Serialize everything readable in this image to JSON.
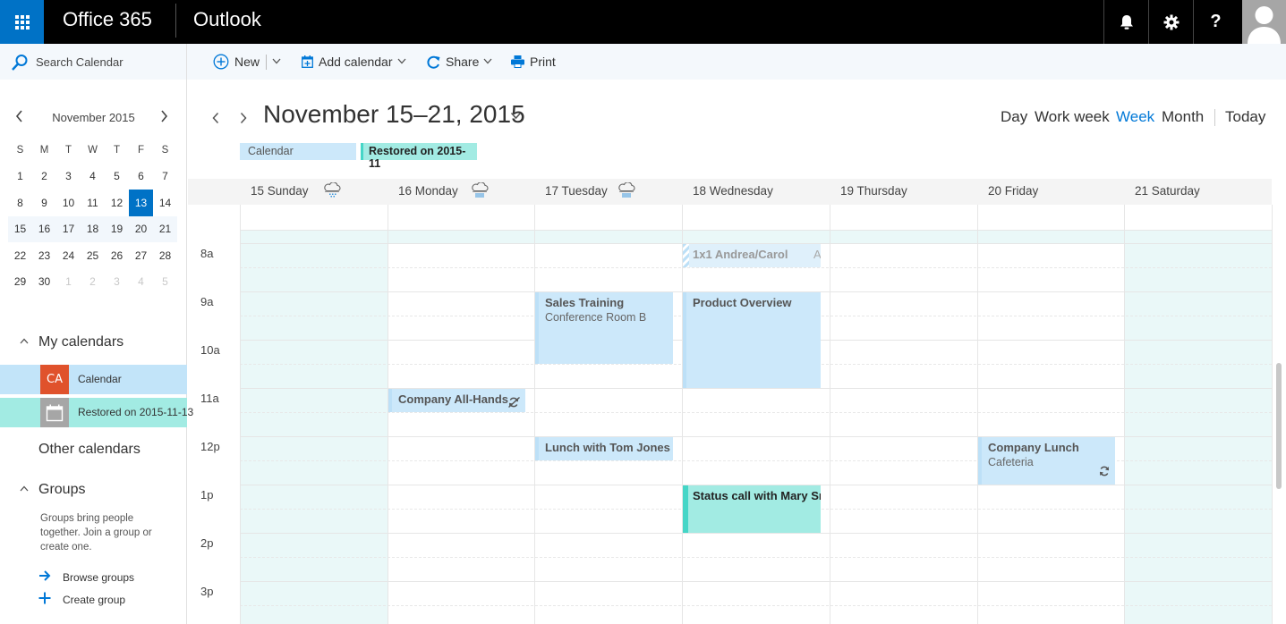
{
  "topbar": {
    "brand": "Office 365",
    "app": "Outlook",
    "icons": [
      "app-launcher-icon",
      "bell-icon",
      "gear-icon",
      "help-icon",
      "avatar-icon"
    ],
    "help_label": "?"
  },
  "commandbar": {
    "search_placeholder": "Search Calendar",
    "new_label": "New",
    "add_calendar_label": "Add calendar",
    "share_label": "Share",
    "print_label": "Print"
  },
  "minicalendar": {
    "month_label": "November 2015",
    "weekday_headers": [
      "S",
      "M",
      "T",
      "W",
      "T",
      "F",
      "S"
    ],
    "weeks": [
      [
        {
          "d": "1"
        },
        {
          "d": "2"
        },
        {
          "d": "3"
        },
        {
          "d": "4"
        },
        {
          "d": "5"
        },
        {
          "d": "6"
        },
        {
          "d": "7"
        }
      ],
      [
        {
          "d": "8"
        },
        {
          "d": "9"
        },
        {
          "d": "10"
        },
        {
          "d": "11"
        },
        {
          "d": "12"
        },
        {
          "d": "13",
          "selected": true
        },
        {
          "d": "14"
        }
      ],
      [
        {
          "d": "15"
        },
        {
          "d": "16"
        },
        {
          "d": "17"
        },
        {
          "d": "18"
        },
        {
          "d": "19"
        },
        {
          "d": "20"
        },
        {
          "d": "21"
        }
      ],
      [
        {
          "d": "22"
        },
        {
          "d": "23"
        },
        {
          "d": "24"
        },
        {
          "d": "25"
        },
        {
          "d": "26"
        },
        {
          "d": "27"
        },
        {
          "d": "28"
        }
      ],
      [
        {
          "d": "29"
        },
        {
          "d": "30"
        },
        {
          "d": "1",
          "other": true
        },
        {
          "d": "2",
          "other": true
        },
        {
          "d": "3",
          "other": true
        },
        {
          "d": "4",
          "other": true
        },
        {
          "d": "5",
          "other": true
        }
      ]
    ],
    "highlighted_week_index": 2
  },
  "leftnav": {
    "my_calendars_label": "My calendars",
    "calendars": [
      {
        "badge": "CA",
        "name": "Calendar",
        "color": "#e0522c",
        "row_bg": "#c2e4f9"
      },
      {
        "badge": "",
        "name": "Restored on 2015-11-13",
        "color": "#a6a6a6",
        "row_bg": "#a2ebe3"
      }
    ],
    "other_calendars_label": "Other calendars",
    "groups_label": "Groups",
    "groups_description": "Groups bring people together. Join a group or create one.",
    "browse_groups_label": "Browse groups",
    "create_group_label": "Create group"
  },
  "header": {
    "date_range": "November 15–21, 2015",
    "legend": [
      {
        "label": "Calendar",
        "bg": "#cce8fa",
        "color": "#555",
        "bold": false
      },
      {
        "label": "Restored on 2015-11",
        "bg": "#a2ebe3",
        "accent": "#45d6c7",
        "color": "#222",
        "bold": true
      }
    ],
    "views": [
      "Day",
      "Work week",
      "Week",
      "Month"
    ],
    "active_view": "Week",
    "today_label": "Today"
  },
  "week": {
    "days": [
      {
        "label": "15 Sunday",
        "weather": "light-rain-icon",
        "weekend": true
      },
      {
        "label": "16 Monday",
        "weather": "rain-icon",
        "weekend": false
      },
      {
        "label": "17 Tuesday",
        "weather": "rain-icon",
        "weekend": false
      },
      {
        "label": "18 Wednesday",
        "weather": "",
        "weekend": false
      },
      {
        "label": "19 Thursday",
        "weather": "",
        "weekend": false
      },
      {
        "label": "20 Friday",
        "weather": "",
        "weekend": false
      },
      {
        "label": "21 Saturday",
        "weather": "",
        "weekend": true
      }
    ],
    "hours": [
      "8a",
      "9a",
      "10a",
      "11a",
      "12p",
      "1p",
      "2p",
      "3p"
    ],
    "events": [
      {
        "title": "1x1 Andrea/Carol",
        "location": "Andrea",
        "day": 3,
        "start": 8.0,
        "end": 8.5,
        "style": "tentative",
        "inline_location": true
      },
      {
        "title": "Sales Training",
        "location": "Conference Room B",
        "day": 2,
        "start": 9.0,
        "end": 10.5,
        "style": "default"
      },
      {
        "title": "Product Overview",
        "location": "",
        "day": 3,
        "start": 9.0,
        "end": 11.0,
        "style": "default"
      },
      {
        "title": "Company All-Hands",
        "location": "",
        "day": 1,
        "start": 11.0,
        "end": 11.5,
        "style": "default",
        "icon": "recurrence-exception-icon"
      },
      {
        "title": "Lunch with Tom Jones",
        "location": "",
        "day": 2,
        "start": 12.0,
        "end": 12.5,
        "style": "default"
      },
      {
        "title": "Company Lunch",
        "location": "Cafeteria",
        "day": 5,
        "start": 12.0,
        "end": 13.0,
        "style": "default",
        "icon": "recurring-icon"
      },
      {
        "title": "Status call with Mary Sr",
        "location": "",
        "day": 3,
        "start": 13.0,
        "end": 14.0,
        "style": "teal"
      }
    ]
  }
}
